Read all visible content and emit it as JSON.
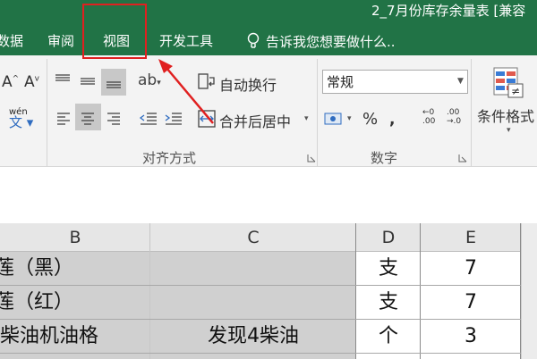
{
  "window": {
    "title": "2_7月份库存余量表 [兼容",
    "tabs": {
      "data": "数据",
      "review": "审阅",
      "view": "视图",
      "developer": "开发工具"
    },
    "tell_me": "告诉我您想要做什么..",
    "accent_color": "#217346",
    "highlight_color": "#e02020"
  },
  "ribbon": {
    "alignment": {
      "wrap_text": "自动换行",
      "merge_center": "合并后居中",
      "group_label": "对齐方式",
      "phonetic_label": "wén"
    },
    "number": {
      "format_value": "常规",
      "group_label": "数字",
      "percent_symbol": "%"
    },
    "styles": {
      "conditional_format": "条件格式"
    },
    "font": {
      "grow_font": "A",
      "shrink_font": "A"
    }
  },
  "sheet": {
    "columns": [
      "B",
      "C",
      "D",
      "E"
    ],
    "rows": [
      {
        "b": "莲（黑）",
        "c": "",
        "d": "支",
        "e": "7"
      },
      {
        "b": "莲（红）",
        "c": "",
        "d": "支",
        "e": "7"
      },
      {
        "b": "柴油机油格",
        "c": "发现4柴油",
        "d": "个",
        "e": "3"
      }
    ]
  }
}
